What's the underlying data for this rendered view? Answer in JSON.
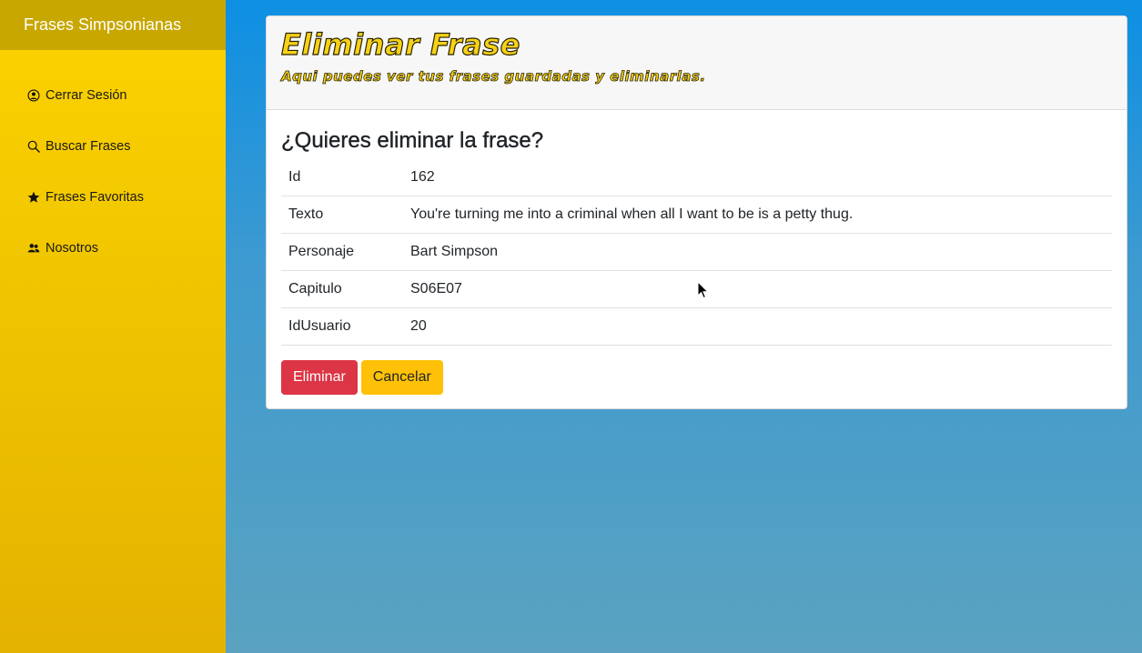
{
  "sidebar": {
    "brand": "Frases Simpsonianas",
    "items": [
      {
        "label": "Cerrar Sesión",
        "icon": "user-circle-icon"
      },
      {
        "label": "Buscar Frases",
        "icon": "search-icon"
      },
      {
        "label": "Frases Favoritas",
        "icon": "star-icon"
      },
      {
        "label": "Nosotros",
        "icon": "people-icon"
      }
    ]
  },
  "card": {
    "title": "Eliminar Frase",
    "subtitle": "Aqui puedes ver tus frases guardadas y eliminarlas.",
    "question": "¿Quieres eliminar la frase?",
    "rows": [
      {
        "key": "Id",
        "value": "162"
      },
      {
        "key": "Texto",
        "value": "You're turning me into a criminal when all I want to be is a petty thug."
      },
      {
        "key": "Personaje",
        "value": "Bart Simpson"
      },
      {
        "key": "Capitulo",
        "value": "S06E07"
      },
      {
        "key": "IdUsuario",
        "value": "20"
      }
    ],
    "delete_label": "Eliminar",
    "cancel_label": "Cancelar"
  },
  "colors": {
    "sidebar_top": "#fed300",
    "sidebar_brand": "#c8a700",
    "background_top": "#0d8fe3",
    "danger": "#dc3545",
    "warning": "#ffc107"
  }
}
